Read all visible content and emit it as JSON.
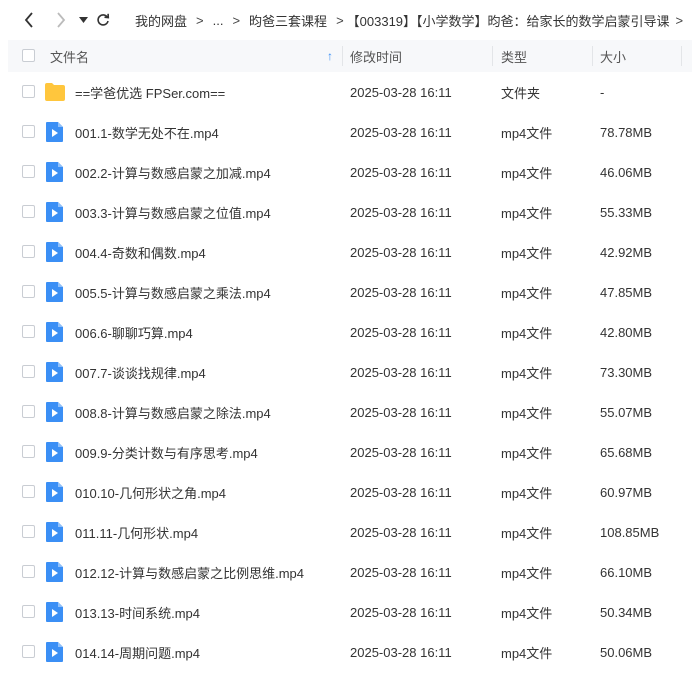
{
  "nav": {
    "back_icon": "chevron-left-icon",
    "forward_icon": "chevron-right-icon",
    "history_icon": "caret-down-icon",
    "refresh_icon": "refresh-icon"
  },
  "breadcrumb": {
    "items": [
      "我的网盘",
      "...",
      "昀爸三套课程",
      "【003319】【小学数学】昀爸：给家长的数学启蒙引导课"
    ],
    "separator": ">"
  },
  "table": {
    "columns": {
      "name": "文件名",
      "modified": "修改时间",
      "type": "类型",
      "size": "大小"
    },
    "sort_indicator": "↑",
    "rows": [
      {
        "name": "==学爸优选 FPSer.com==",
        "modified": "2025-03-28 16:11",
        "type": "文件夹",
        "size": "-",
        "icon": "folder-icon"
      },
      {
        "name": "001.1-数学无处不在.mp4",
        "modified": "2025-03-28 16:11",
        "type": "mp4文件",
        "size": "78.78MB",
        "icon": "video-file-icon"
      },
      {
        "name": "002.2-计算与数感启蒙之加减.mp4",
        "modified": "2025-03-28 16:11",
        "type": "mp4文件",
        "size": "46.06MB",
        "icon": "video-file-icon"
      },
      {
        "name": "003.3-计算与数感启蒙之位值.mp4",
        "modified": "2025-03-28 16:11",
        "type": "mp4文件",
        "size": "55.33MB",
        "icon": "video-file-icon"
      },
      {
        "name": "004.4-奇数和偶数.mp4",
        "modified": "2025-03-28 16:11",
        "type": "mp4文件",
        "size": "42.92MB",
        "icon": "video-file-icon"
      },
      {
        "name": "005.5-计算与数感启蒙之乘法.mp4",
        "modified": "2025-03-28 16:11",
        "type": "mp4文件",
        "size": "47.85MB",
        "icon": "video-file-icon"
      },
      {
        "name": "006.6-聊聊巧算.mp4",
        "modified": "2025-03-28 16:11",
        "type": "mp4文件",
        "size": "42.80MB",
        "icon": "video-file-icon"
      },
      {
        "name": "007.7-谈谈找规律.mp4",
        "modified": "2025-03-28 16:11",
        "type": "mp4文件",
        "size": "73.30MB",
        "icon": "video-file-icon"
      },
      {
        "name": "008.8-计算与数感启蒙之除法.mp4",
        "modified": "2025-03-28 16:11",
        "type": "mp4文件",
        "size": "55.07MB",
        "icon": "video-file-icon"
      },
      {
        "name": "009.9-分类计数与有序思考.mp4",
        "modified": "2025-03-28 16:11",
        "type": "mp4文件",
        "size": "65.68MB",
        "icon": "video-file-icon"
      },
      {
        "name": "010.10-几何形状之角.mp4",
        "modified": "2025-03-28 16:11",
        "type": "mp4文件",
        "size": "60.97MB",
        "icon": "video-file-icon"
      },
      {
        "name": "011.11-几何形状.mp4",
        "modified": "2025-03-28 16:11",
        "type": "mp4文件",
        "size": "108.85MB",
        "icon": "video-file-icon"
      },
      {
        "name": "012.12-计算与数感启蒙之比例思维.mp4",
        "modified": "2025-03-28 16:11",
        "type": "mp4文件",
        "size": "66.10MB",
        "icon": "video-file-icon"
      },
      {
        "name": "013.13-时间系统.mp4",
        "modified": "2025-03-28 16:11",
        "type": "mp4文件",
        "size": "50.34MB",
        "icon": "video-file-icon"
      },
      {
        "name": "014.14-周期问题.mp4",
        "modified": "2025-03-28 16:11",
        "type": "mp4文件",
        "size": "50.06MB",
        "icon": "video-file-icon"
      }
    ]
  },
  "colors": {
    "header_bg": "#f7f8fa",
    "folder": "#ffc63d",
    "video_icon": "#3b8ff5",
    "sort_arrow": "#3b8ff5"
  }
}
